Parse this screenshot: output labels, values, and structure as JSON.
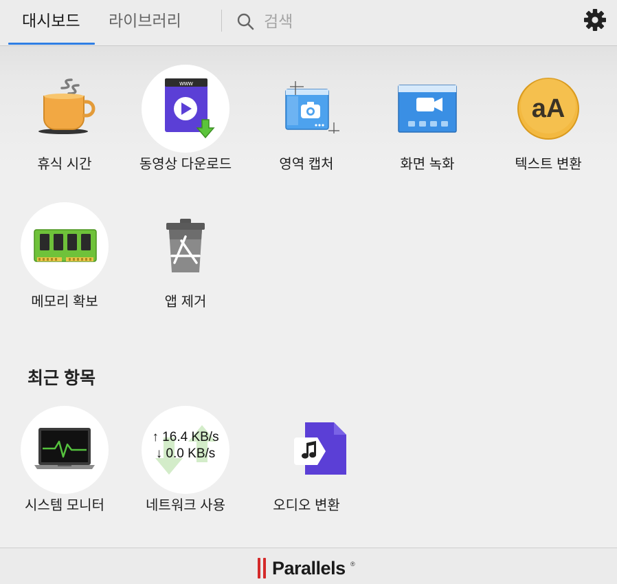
{
  "header": {
    "tabs": [
      {
        "label": "대시보드",
        "active": true
      },
      {
        "label": "라이브러리",
        "active": false
      }
    ],
    "search_placeholder": "검색",
    "icons": {
      "search": "search-icon",
      "settings": "gear-icon"
    },
    "accent_color": "#2f7ee4"
  },
  "tools": [
    {
      "label": "휴식 시간",
      "icon": "coffee-cup-icon"
    },
    {
      "label": "동영상 다운로드",
      "icon": "video-download-icon"
    },
    {
      "label": "영역 캡처",
      "icon": "area-capture-icon"
    },
    {
      "label": "화면 녹화",
      "icon": "screen-record-icon"
    },
    {
      "label": "텍스트 변환",
      "icon": "text-convert-icon"
    },
    {
      "label": "메모리 확보",
      "icon": "memory-ram-icon"
    },
    {
      "label": "앱 제거",
      "icon": "app-trash-icon"
    }
  ],
  "recent": {
    "title": "최근 항목",
    "items": [
      {
        "label": "시스템 모니터",
        "icon": "system-monitor-icon"
      },
      {
        "label": "네트워크 사용",
        "icon": "network-usage-icon",
        "upload": "↑ 16.4 KB/s",
        "download": "↓ 0.0 KB/s"
      },
      {
        "label": "오디오 변환",
        "icon": "audio-convert-icon"
      }
    ]
  },
  "text_convert_glyph": "aA",
  "download_page_text": "www",
  "footer": {
    "brand": "Parallels",
    "registered_mark": "®",
    "brand_color": "#d42a2a"
  }
}
